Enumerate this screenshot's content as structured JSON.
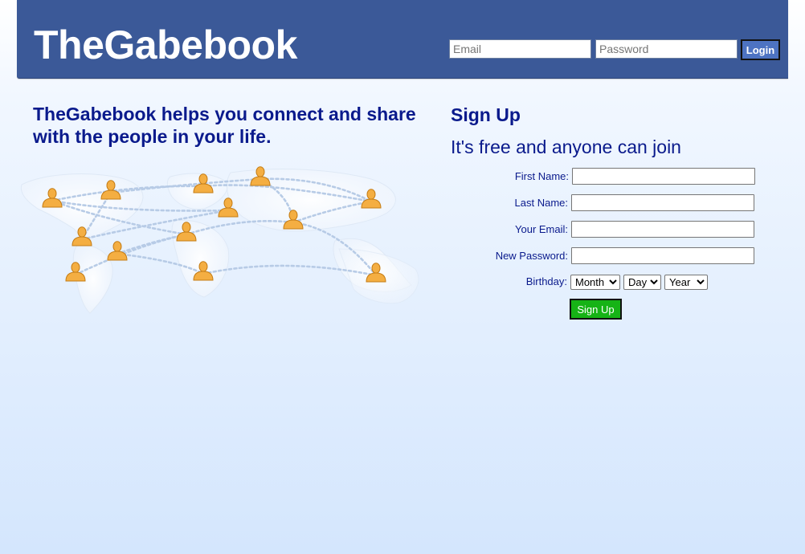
{
  "header": {
    "logo": "TheGabebook",
    "email_placeholder": "Email",
    "password_placeholder": "Password",
    "login_label": "Login"
  },
  "intro": {
    "tagline": "TheGabebook helps you connect and share with the people in your life."
  },
  "signup": {
    "title": "Sign Up",
    "subtitle": "It's free and anyone can join",
    "first_name_label": "First Name:",
    "last_name_label": "Last Name:",
    "email_label": "Your Email:",
    "password_label": "New Password:",
    "birthday_label": "Birthday:",
    "month_selected": "Month",
    "day_selected": "Day",
    "year_selected": "Year",
    "button_label": "Sign Up"
  },
  "colors": {
    "header_bg": "#3b5998",
    "heading_text": "#0a1a8c",
    "login_button": "#4d73c2",
    "signup_button": "#16b316",
    "person_icon": "#f0a83c"
  }
}
